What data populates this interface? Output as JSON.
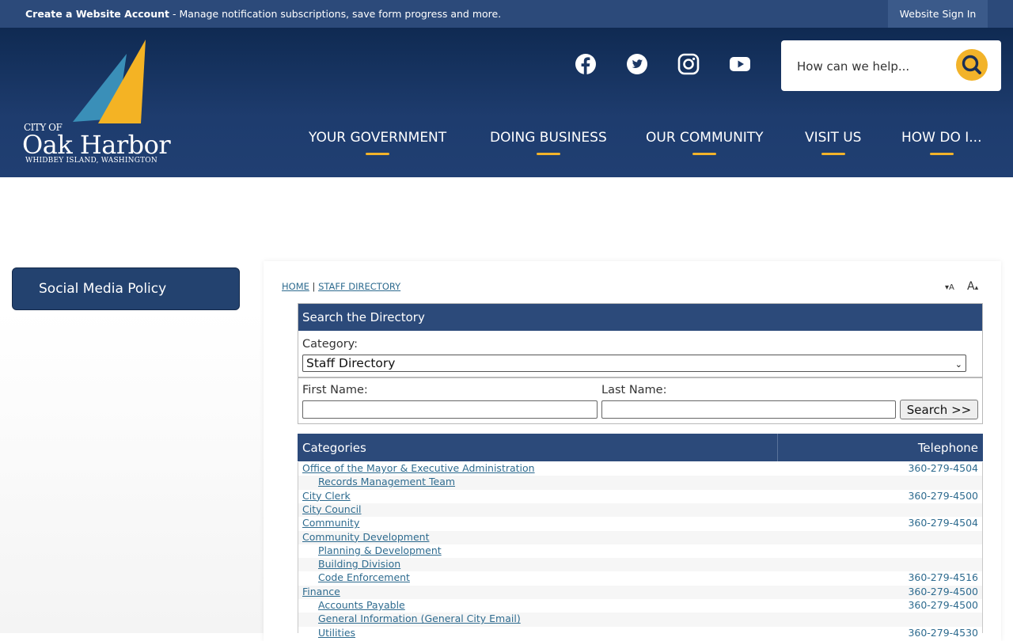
{
  "topbar": {
    "create_account": "Create a Website Account",
    "message": " - Manage notification subscriptions, save form progress and more.",
    "sign_in": "Website Sign In"
  },
  "logo": {
    "city_of": "CITY OF",
    "name": "Oak Harbor",
    "tagline": "WHIDBEY ISLAND, WASHINGTON"
  },
  "social": [
    "facebook-icon",
    "twitter-icon",
    "instagram-icon",
    "youtube-icon"
  ],
  "search": {
    "placeholder": "How can we help..."
  },
  "nav": [
    {
      "label": "YOUR GOVERNMENT"
    },
    {
      "label": "DOING BUSINESS"
    },
    {
      "label": "OUR COMMUNITY"
    },
    {
      "label": "VISIT US"
    },
    {
      "label": "HOW DO I..."
    }
  ],
  "sidebar": {
    "item": "Social Media Policy"
  },
  "breadcrumb": {
    "home": "HOME",
    "sep": "|",
    "current": "STAFF DIRECTORY"
  },
  "resize": {
    "smaller": "A",
    "larger": "A"
  },
  "directory": {
    "title": "Search the Directory",
    "category_label": "Category:",
    "category_value": "Staff Directory",
    "first_name_label": "First Name:",
    "last_name_label": "Last Name:",
    "search_button": "Search >>"
  },
  "table": {
    "col_categories": "Categories",
    "col_telephone": "Telephone",
    "rows": [
      {
        "name": "Office of the Mayor & Executive Administration",
        "indent": false,
        "tel": "360-279-4504"
      },
      {
        "name": "Records Management Team",
        "indent": true,
        "tel": ""
      },
      {
        "name": "City Clerk",
        "indent": false,
        "tel": "360-279-4500"
      },
      {
        "name": "City Council",
        "indent": false,
        "tel": ""
      },
      {
        "name": "Community",
        "indent": false,
        "tel": "360-279-4504"
      },
      {
        "name": "Community Development",
        "indent": false,
        "tel": ""
      },
      {
        "name": "Planning & Development",
        "indent": true,
        "tel": ""
      },
      {
        "name": "Building Division",
        "indent": true,
        "tel": ""
      },
      {
        "name": "Code Enforcement",
        "indent": true,
        "tel": "360-279-4516"
      },
      {
        "name": "Finance",
        "indent": false,
        "tel": "360-279-4500"
      },
      {
        "name": "Accounts Payable",
        "indent": true,
        "tel": "360-279-4500"
      },
      {
        "name": "General Information (General City Email)",
        "indent": true,
        "tel": ""
      },
      {
        "name": "Utilities",
        "indent": true,
        "tel": "360-279-4530"
      }
    ]
  },
  "colors": {
    "navy": "#2c4a7a",
    "gold": "#f2b32a",
    "link": "#2e6b8f"
  }
}
